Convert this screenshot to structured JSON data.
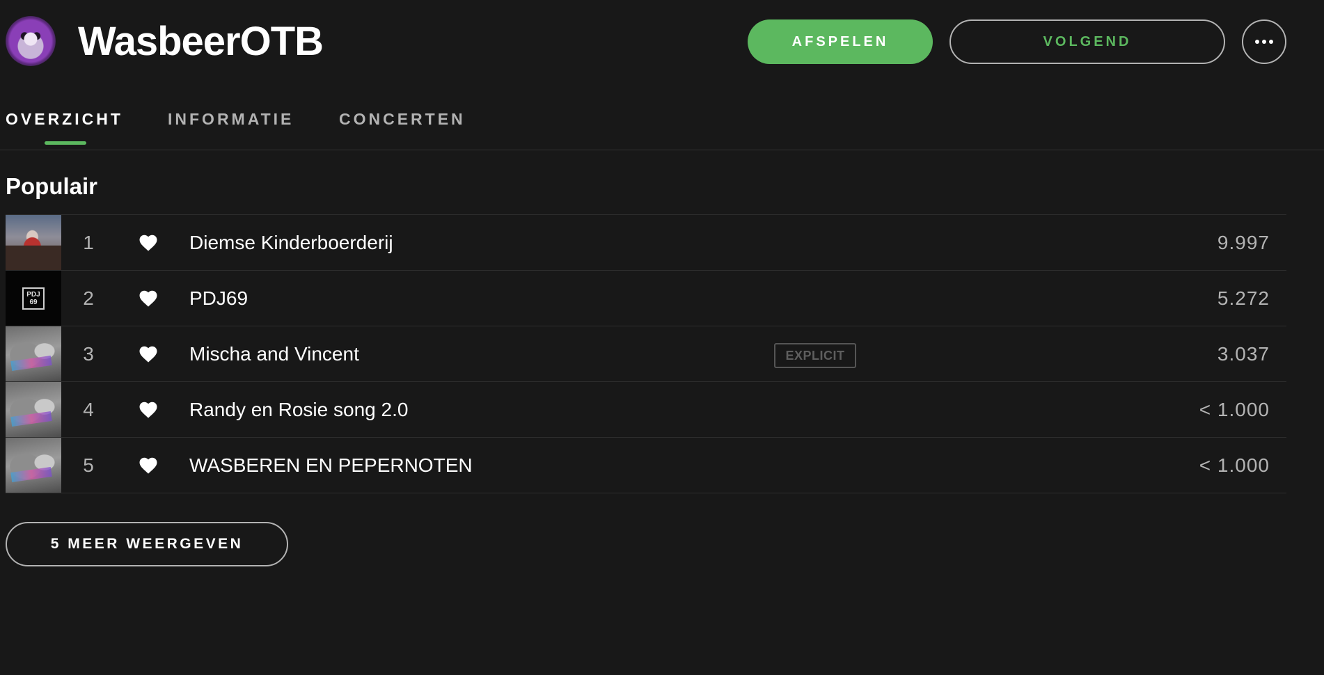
{
  "artist": {
    "name": "WasbeerOTB",
    "avatar_icon": "artist-avatar-image"
  },
  "actions": {
    "play_label": "AFSPELEN",
    "follow_label": "VOLGEND",
    "more_icon": "ellipsis-icon"
  },
  "tabs": [
    {
      "label": "OVERZICHT",
      "active": true
    },
    {
      "label": "INFORMATIE",
      "active": false
    },
    {
      "label": "CONCERTEN",
      "active": false
    }
  ],
  "popular": {
    "title": "Populair",
    "tracks": [
      {
        "number": "1",
        "title": "Diemse Kinderboerderij",
        "plays": "9.997",
        "explicit": false,
        "liked": true
      },
      {
        "number": "2",
        "title": "PDJ69",
        "plays": "5.272",
        "explicit": false,
        "liked": true
      },
      {
        "number": "3",
        "title": "Mischa and Vincent",
        "plays": "3.037",
        "explicit": true,
        "explicit_label": "EXPLICIT",
        "liked": true
      },
      {
        "number": "4",
        "title": "Randy en Rosie song 2.0",
        "plays": "< 1.000",
        "explicit": false,
        "liked": true
      },
      {
        "number": "5",
        "title": "WASBEREN EN PEPERNOTEN",
        "plays": "< 1.000",
        "explicit": false,
        "liked": true
      }
    ],
    "cover_2_text": [
      "PDJ",
      "69"
    ],
    "show_more_label": "5 MEER WEERGEVEN"
  },
  "colors": {
    "background": "#181818",
    "accent_green": "#5cb85f",
    "text_primary": "#ffffff",
    "text_secondary": "#b3b3b3"
  }
}
